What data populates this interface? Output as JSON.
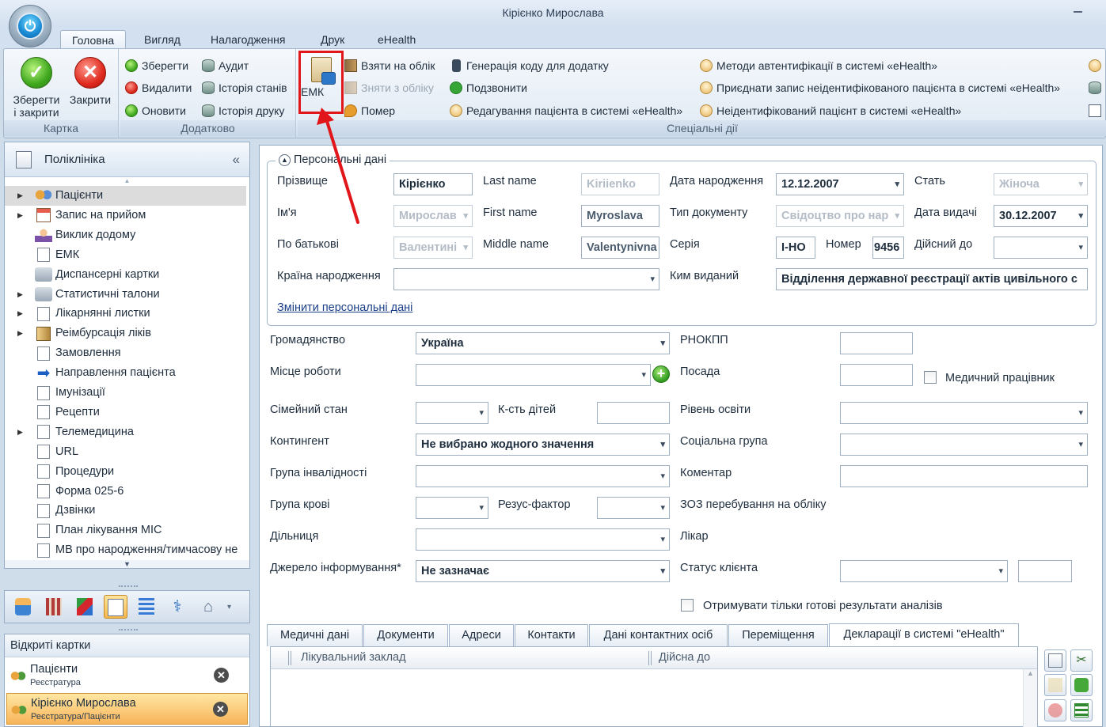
{
  "window": {
    "title": "Кірієнко Мирослава"
  },
  "ribbon": {
    "tabs": [
      "Головна",
      "Вигляд",
      "Налагодження",
      "Друк",
      "eHealth"
    ],
    "groups": {
      "card": {
        "label": "Картка",
        "save_close": "Зберегти\nі закрити",
        "save_close_l1": "Зберегти",
        "save_close_l2": "і закрити",
        "close": "Закрити"
      },
      "extra": {
        "label": "Додатково",
        "save": "Зберегти",
        "delete": "Видалити",
        "refresh": "Оновити",
        "audit": "Аудит",
        "history": "Історія станів",
        "print_history": "Історія друку"
      },
      "special": {
        "label": "Спеціальні дії",
        "emk": "ЕМК",
        "register": "Взяти на облік",
        "deregister": "Зняти з обліку",
        "died": "Помер",
        "gen_code": "Генерація коду для додатку",
        "call": "Подзвонити",
        "edit_ehealth": "Редагування пацієнта в системі «eHealth»",
        "auth_methods": "Методи автентифікації в системі «eHealth»",
        "attach_record": "Приєднати запис неідентифікованого пацієнта в системі «eHealth»",
        "unidentified": "Неідентифікований пацієнт в системі «eHealth»"
      }
    }
  },
  "nav": {
    "title": "Поліклініка",
    "items": [
      {
        "label": "Пацієнти",
        "icon": "patients-icon",
        "expand": true,
        "selected": true
      },
      {
        "label": "Запис на прийом",
        "icon": "appointment-icon",
        "expand": true
      },
      {
        "label": "Виклик додому",
        "icon": "home-visit-icon",
        "expand": false
      },
      {
        "label": "ЕМК",
        "icon": "emk-icon",
        "expand": false
      },
      {
        "label": "Диспансерні картки",
        "icon": "dispensary-icon",
        "expand": false
      },
      {
        "label": "Статистичні талони",
        "icon": "stat-coupons-icon",
        "expand": true
      },
      {
        "label": "Лікарнянні листки",
        "icon": "sick-leave-icon",
        "expand": true
      },
      {
        "label": "Реімбурсація ліків",
        "icon": "reimbursement-icon",
        "expand": true
      },
      {
        "label": "Замовлення",
        "icon": "orders-icon",
        "expand": false
      },
      {
        "label": "Направлення пацієнта",
        "icon": "referral-icon",
        "expand": false
      },
      {
        "label": "Імунізації",
        "icon": "immunization-icon",
        "expand": false
      },
      {
        "label": "Рецепти",
        "icon": "prescriptions-icon",
        "expand": false
      },
      {
        "label": "Телемедицина",
        "icon": "telemedicine-icon",
        "expand": true
      },
      {
        "label": "URL",
        "icon": "url-icon",
        "expand": false
      },
      {
        "label": "Процедури",
        "icon": "procedures-icon",
        "expand": false
      },
      {
        "label": "Форма 025-6",
        "icon": "form-icon",
        "expand": false
      },
      {
        "label": "Дзвінки",
        "icon": "calls-icon",
        "expand": false
      },
      {
        "label": "План лікування МІС",
        "icon": "treatment-plan-icon",
        "expand": false
      },
      {
        "label": "МВ про народження/тимчасову не",
        "icon": "birth-record-icon",
        "expand": false
      }
    ]
  },
  "open_cards": {
    "title": "Відкриті картки",
    "cards": [
      {
        "title": "Пацієнти",
        "path": "Реєстратура"
      },
      {
        "title": "Кірієнко Мирослава",
        "path": "Реєстратура/Пацієнти"
      }
    ]
  },
  "personal": {
    "legend": "Персональні дані",
    "surname_label": "Прізвище",
    "surname": "Кірієнко",
    "lastname_label": "Last name",
    "lastname": "Kiriienko",
    "birth_label": "Дата народження",
    "birth": "12.12.2007",
    "sex_label": "Стать",
    "sex": "Жіноча",
    "name_label": "Ім'я",
    "name": "Мирослав",
    "firstname_label": "First name",
    "firstname": "Myroslava",
    "doctype_label": "Тип документу",
    "doctype": "Свідоцтво про нар",
    "issue_label": "Дата видачі",
    "issue": "30.12.2007",
    "patronymic_label": "По батькові",
    "patronymic": "Валентині",
    "middlename_label": "Middle name",
    "middlename": "Valentynivna",
    "series_label": "Серія",
    "series": "І-НО",
    "number_label": "Номер",
    "number": "9456",
    "valid_label": "Дійсний до",
    "valid": "",
    "birth_country_label": "Країна народження",
    "birth_country": "",
    "issued_by_label": "Ким виданий",
    "issued_by": "Відділення державної реєстрації актів цивільного с",
    "change_link": "Змінити персональні дані"
  },
  "form": {
    "citizenship_label": "Громадянство",
    "citizenship": "Україна",
    "rnokpp_label": "РНОКПП",
    "rnokpp": "",
    "work_label": "Місце роботи",
    "work": "",
    "position_label": "Посада",
    "position": "",
    "medworker_label": "Медичний працівник",
    "marital_label": "Сімейний стан",
    "marital": "",
    "children_label": "К-сть дітей",
    "children": "",
    "education_label": "Рівень освіти",
    "education": "",
    "contingent_label": "Контингент",
    "contingent": "Не вибрано жодного значення",
    "social_label": "Соціальна група",
    "social": "",
    "disability_label": "Група інвалідності",
    "disability": "",
    "comment_label": "Коментар",
    "comment": "",
    "blood_label": "Група крові",
    "blood": "",
    "rh_label": "Резус-фактор",
    "rh": "",
    "zoz_label": "ЗОЗ перебування на обліку",
    "district_label": "Дільниця",
    "district": "",
    "doctor_label": "Лікар",
    "source_label": "Джерело інформування*",
    "source": "Не зазначає",
    "client_status_label": "Статус клієнта",
    "client_status": "",
    "ready_results_label": "Отримувати тільки готові результати аналізів"
  },
  "bottom_tabs": [
    "Медичні дані",
    "Документи",
    "Адреси",
    "Контакти",
    "Дані контактних осіб",
    "Переміщення",
    "Декларації в системі \"eHealth\""
  ],
  "grid": {
    "columns": [
      "Лікувальний заклад",
      "Дійсна до"
    ]
  },
  "colors": {
    "highlight_box": "#e0161a",
    "arrow": "#e0161a",
    "selected_card": "#f8b45a"
  }
}
